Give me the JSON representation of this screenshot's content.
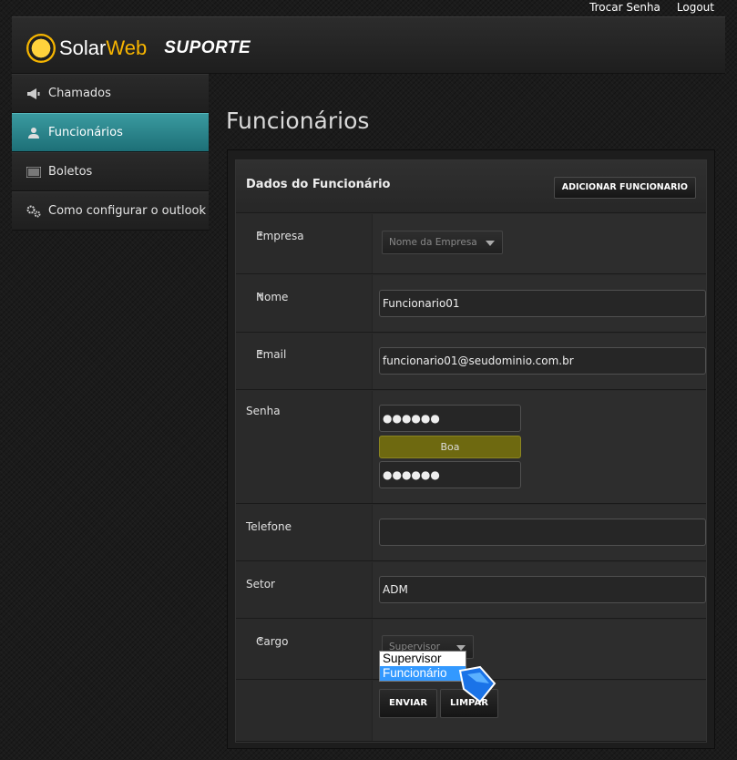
{
  "topbar": {
    "change_password": "Trocar Senha",
    "logout": "Logout"
  },
  "brand": {
    "logo_part1": "Solar",
    "logo_part2": "Web",
    "section": "SUPORTE",
    "accent": "#f7b500"
  },
  "sidebar": {
    "items": [
      {
        "label": "Chamados",
        "icon": "megaphone-icon"
      },
      {
        "label": "Funcionários",
        "icon": "user-icon",
        "active": true
      },
      {
        "label": "Boletos",
        "icon": "barcode-icon"
      },
      {
        "label": "Como configurar o outlook",
        "icon": "gears-icon"
      }
    ],
    "active_color": "#2a8a90"
  },
  "page": {
    "title": "Funcionários"
  },
  "form": {
    "title": "Dados do Funcionário",
    "add_button": "ADICIONAR FUNCIONARIO",
    "fields": {
      "empresa": {
        "label": "Empresa",
        "required": "*",
        "placeholder": "Nome da Empresa"
      },
      "nome": {
        "label": "Nome",
        "required": "*",
        "value": "Funcionario01"
      },
      "email": {
        "label": "Email",
        "required": "*",
        "value": "funcionario01@seudominio.com.br"
      },
      "senha": {
        "label": "Senha",
        "value": "●●●●●●",
        "strength": "Boa",
        "confirm": "●●●●●●"
      },
      "telefone": {
        "label": "Telefone",
        "value": ""
      },
      "setor": {
        "label": "Setor",
        "value": "ADM"
      },
      "cargo": {
        "label": "Cargo",
        "required": "*",
        "selected": "Supervisor",
        "options": [
          "Supervisor",
          "Funcionário"
        ],
        "highlighted": "Funcionário"
      }
    },
    "submit": "ENVIAR",
    "clear": "LIMPAR"
  }
}
